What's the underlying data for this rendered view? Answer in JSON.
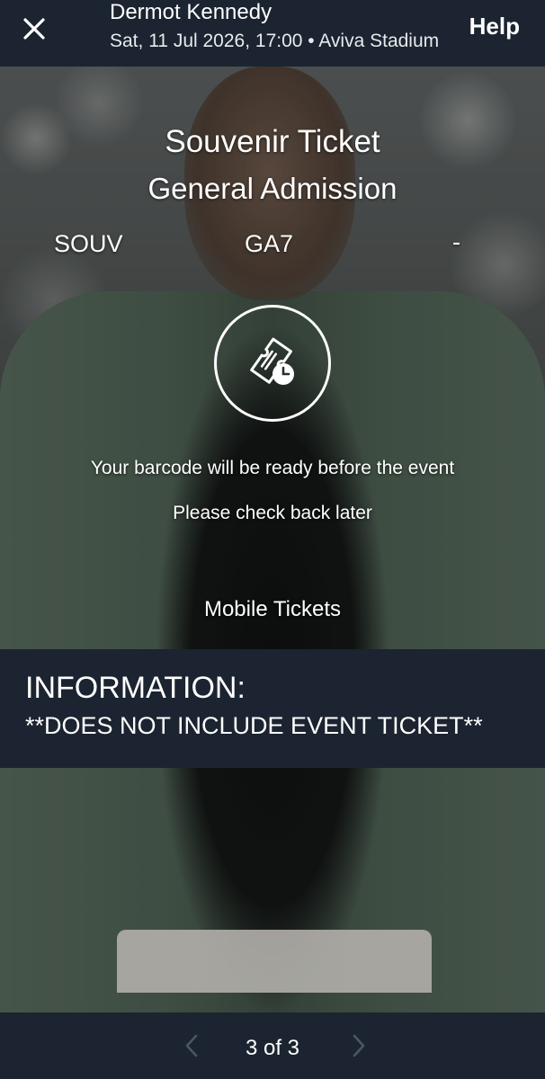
{
  "header": {
    "title": "Dermot Kennedy",
    "subtitle": "Sat, 11 Jul 2026, 17:00 • Aviva Stadium",
    "help_label": "Help"
  },
  "ticket": {
    "type": "Souvenir Ticket",
    "admission": "General Admission",
    "section": "SOUV",
    "row": "GA7",
    "seat": "-",
    "barcode_message": "Your barcode will be ready before the event",
    "check_back": "Please check back later",
    "delivery": "Mobile Tickets"
  },
  "information": {
    "heading": "INFORMATION:",
    "text": "**DOES NOT INCLUDE EVENT TICKET**"
  },
  "pagination": {
    "label": "3 of 3"
  },
  "icons": {
    "close": "close-icon",
    "ticket_clock": "ticket-clock-icon",
    "prev": "chevron-left-icon",
    "next": "chevron-right-icon"
  },
  "colors": {
    "bar_background": "#1b2430",
    "text": "#ffffff",
    "disabled_chevron": "#4a5566"
  }
}
